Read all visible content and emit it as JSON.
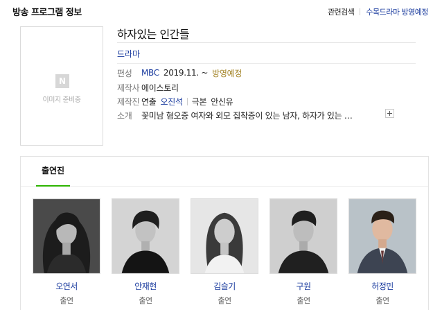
{
  "header": {
    "title": "방송 프로그램 정보",
    "related_search": "관련검색",
    "more_link": "수목드라마 방영예정"
  },
  "poster": {
    "logo_text": "N",
    "placeholder": "이미지 준비중"
  },
  "show": {
    "title": "하자있는 인간들",
    "genre": "드라마",
    "schedule": {
      "label": "편성",
      "channel": "MBC",
      "date": "2019.11. ~",
      "status": "방영예정"
    },
    "producer": {
      "label": "제작사",
      "value": "에이스토리"
    },
    "staff": {
      "label": "제작진",
      "director_role": "연출",
      "director_name": "오진석",
      "writer_role": "극본",
      "writer_name": "안신유"
    },
    "summary": {
      "label": "소개",
      "text": "꽃미남 혐오증 여자와 외모 집착증이 있는 남자, 하자가 있는 …"
    }
  },
  "cast_section": {
    "tab": "출연진",
    "members": [
      {
        "name": "오연서",
        "role": "출연"
      },
      {
        "name": "안재현",
        "role": "출연"
      },
      {
        "name": "김슬기",
        "role": "출연"
      },
      {
        "name": "구원",
        "role": "출연"
      },
      {
        "name": "허정민",
        "role": "출연"
      }
    ]
  },
  "colors": {
    "link_blue": "#1a3b9e",
    "status_gold": "#a5862a",
    "tab_green": "#2db400"
  },
  "icons": [
    "plus-icon",
    "naver-logo-icon"
  ]
}
